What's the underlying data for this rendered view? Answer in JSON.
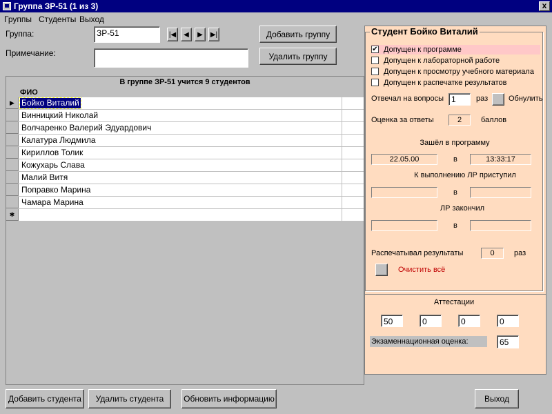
{
  "window": {
    "title": "Группа ЗР-51 (1 из 3)",
    "close": "x"
  },
  "menu": [
    "Группы",
    "Студенты",
    "Выход"
  ],
  "form": {
    "group_label": "Группа:",
    "group_value": "ЗР-51",
    "note_label": "Примечание:",
    "note_value": "",
    "nav": [
      "|◀",
      "◀",
      "▶",
      "▶|"
    ],
    "add_group": "Добавить группу",
    "delete_group": "Удалить группу"
  },
  "grid": {
    "caption": "В группе ЗР-51 учится 9 студентов",
    "header": "ФИО",
    "current_marker": "▶",
    "new_marker": "✱",
    "rows": [
      "Бойко Виталий",
      "Винницкий Николай",
      "Волчаренко Валерий Эдуардович",
      "Калатура Людмила",
      "Кириллов Толик",
      "Кожухарь Слава",
      "Малий Витя",
      "Поправко Марина",
      "Чамара Марина"
    ]
  },
  "student": {
    "legend": "Студент Бойко Виталий",
    "checks": [
      {
        "label": "Допущен к программе",
        "mark": "✔"
      },
      {
        "label": "Допущен к лабораторной работе",
        "mark": ""
      },
      {
        "label": "Допущен к просмотру учебного материала",
        "mark": ""
      },
      {
        "label": "Допущен к распечатке результатов",
        "mark": ""
      }
    ],
    "answered_label": "Отвечал на вопросы",
    "answered_value": "1",
    "answered_unit": "раз",
    "reset_label": "Обнулить",
    "score_label": "Оценка за ответы",
    "score_value": "2",
    "score_unit": "баллов",
    "entered_label": "Зашёл в программу",
    "entered_date": "22.05.00",
    "at": "в",
    "entered_time": "13:33:17",
    "lab_started_label": "К выполнению ЛР приступил",
    "lab_started_date": "",
    "lab_started_time": "",
    "lab_finished_label": "ЛР закончил",
    "lab_finished_date": "",
    "lab_finished_time": "",
    "printed_label": "Распечатывал результаты",
    "printed_value": "0",
    "printed_unit": "раз",
    "clear_all": "Очистить всё"
  },
  "attest": {
    "label": "Аттестации",
    "values": [
      "50",
      "0",
      "0",
      "0"
    ],
    "exam_label": "Экзаменнационная оценка:",
    "exam_value": "65"
  },
  "footer": {
    "add_student": "Добавить студента",
    "delete_student": "Удалить студента",
    "refresh": "Обновить информацию",
    "exit": "Выход"
  },
  "colors": {
    "titlebar": "#000080",
    "panel": "#ffdcc0",
    "face": "#c0c0c0",
    "clear_text": "#c00000",
    "highlight": "#ffc8c8"
  }
}
